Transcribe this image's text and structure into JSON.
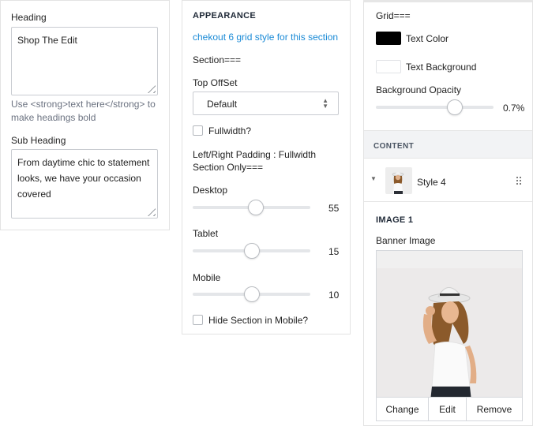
{
  "left_panel": {
    "heading_label": "Heading",
    "heading_value": "Shop The Edit",
    "heading_help": "Use <strong>text here</strong> to make headings bold",
    "subheading_label": "Sub Heading",
    "subheading_value": "From daytime chic to statement looks, we have your occasion covered"
  },
  "middle_panel": {
    "title": "APPEARANCE",
    "link": "chekout 6 grid style for this section",
    "section_marker": "Section===",
    "top_offset_label": "Top OffSet",
    "top_offset_value": "Default",
    "fullwidth_label": "Fullwidth?",
    "fullwidth_checked": false,
    "padding_label": "Left/Right Padding : Fullwidth Section Only===",
    "sliders": [
      {
        "label": "Desktop",
        "value": 55,
        "fill": 0.54
      },
      {
        "label": "Tablet",
        "value": 15,
        "fill": 0.5
      },
      {
        "label": "Mobile",
        "value": 10,
        "fill": 0.5
      }
    ],
    "hide_mobile_label": "Hide Section in Mobile?",
    "hide_mobile_checked": false
  },
  "right_panel": {
    "grid_marker": "Grid===",
    "text_color_label": "Text Color",
    "text_color": "#000000",
    "text_bg_label": "Text Background",
    "text_bg_color": "#ffffff",
    "opacity_label": "Background Opacity",
    "opacity_value": "0.7%",
    "opacity_fill": 0.67,
    "content_caption": "CONTENT",
    "item_label": "Style 4",
    "image_title": "IMAGE 1",
    "banner_label": "Banner Image",
    "buttons": {
      "change": "Change",
      "edit": "Edit",
      "remove": "Remove"
    }
  },
  "icons": {
    "collapse": "caret-down-icon",
    "drag": "drag-handle-icon",
    "select": "up-down-arrows-icon"
  }
}
